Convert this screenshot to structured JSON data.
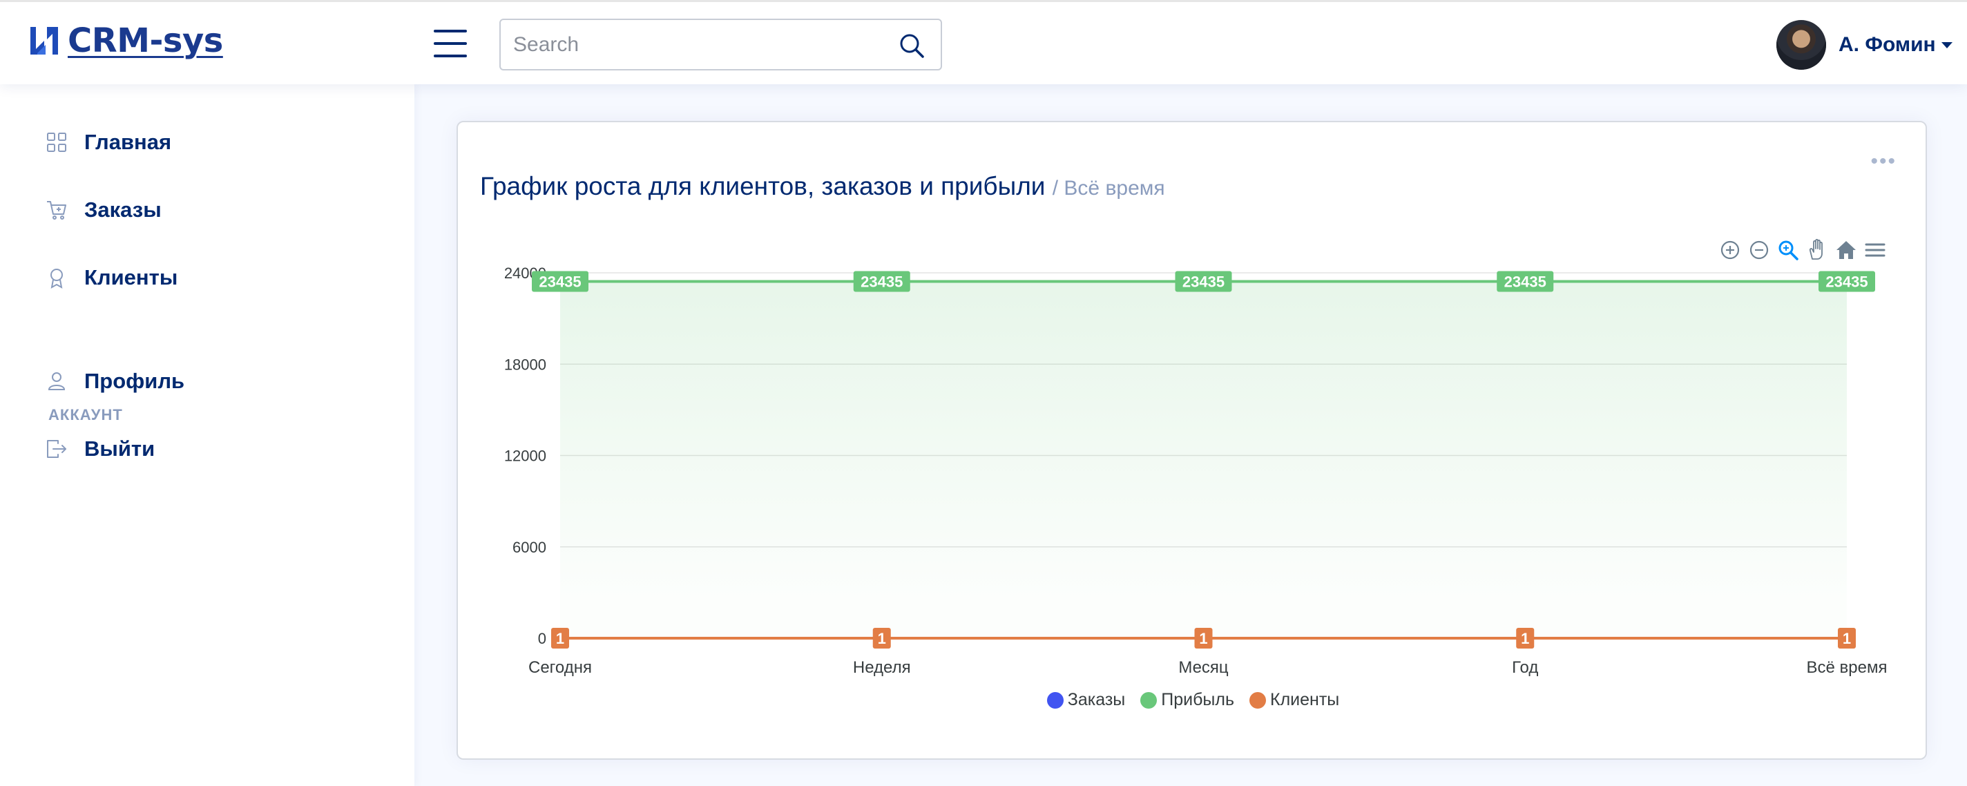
{
  "app": {
    "brand": "CRM-sys",
    "search_placeholder": "Search",
    "user_name": "А. Фомин"
  },
  "sidebar": {
    "items": [
      {
        "label": "Главная",
        "icon": "grid-icon"
      },
      {
        "label": "Заказы",
        "icon": "cart-icon"
      },
      {
        "label": "Клиенты",
        "icon": "award-icon"
      }
    ],
    "heading": "АККАУНТ",
    "account_items": [
      {
        "label": "Профиль",
        "icon": "person-icon"
      },
      {
        "label": "Выйти",
        "icon": "logout-icon"
      }
    ]
  },
  "card": {
    "title": "График роста для клиентов, заказов и прибыли",
    "subtitle": "/ Всё время",
    "menu_icon": "more-icon"
  },
  "toolbar": [
    "zoom-in-icon",
    "zoom-out-icon",
    "zoom-select-icon",
    "pan-hand-icon",
    "home-icon",
    "menu-icon"
  ],
  "colors": {
    "primary": "#012970",
    "accent": "#4154f1",
    "orders": "#4154f1",
    "profit": "#2eca6a",
    "clients": "#ff771d"
  },
  "chart_data": {
    "type": "area",
    "categories": [
      "Сегодня",
      "Неделя",
      "Месяц",
      "Год",
      "Всё время"
    ],
    "series": [
      {
        "name": "Заказы",
        "values": [
          1,
          1,
          1,
          1,
          1
        ],
        "color": "#4154f1"
      },
      {
        "name": "Прибыль",
        "values": [
          23435,
          23435,
          23435,
          23435,
          23435
        ],
        "color": "#69c77a"
      },
      {
        "name": "Клиенты",
        "values": [
          1,
          1,
          1,
          1,
          1
        ],
        "color": "#e27d45"
      }
    ],
    "y_ticks": [
      "0",
      "6000",
      "12000",
      "18000",
      "24000"
    ],
    "ylim": [
      0,
      24000
    ],
    "grid": true,
    "legend": "bottom-center",
    "data_labels": true
  }
}
